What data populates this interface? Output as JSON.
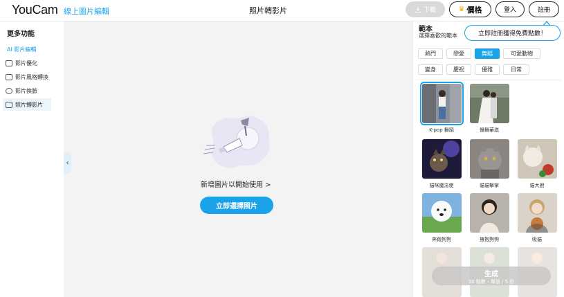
{
  "header": {
    "logo": "YouCam",
    "logo_sub": "線上圖片編輯",
    "title": "照片轉影片",
    "download_label": "下載",
    "price_label": "價格",
    "login_label": "登入",
    "register_label": "註冊"
  },
  "sidebar": {
    "title": "更多功能",
    "section": "AI 影片編輯",
    "items": [
      {
        "label": "影片優化",
        "icon": "video-enhance-icon"
      },
      {
        "label": "影片風格轉換",
        "icon": "style-transfer-icon"
      },
      {
        "label": "影片換臉",
        "icon": "face-swap-icon"
      },
      {
        "label": "照片轉影片",
        "icon": "photo-to-video-icon"
      }
    ]
  },
  "main": {
    "add_prompt": "新增圖片以開始使用 >",
    "cta_label": "立即選擇照片"
  },
  "panel": {
    "title": "範本",
    "subtitle": "選擇喜歡的範本",
    "tooltip": "立即註冊獲得免費點數！",
    "categories": [
      "熱門",
      "戀愛",
      "舞蹈",
      "可愛動物",
      "變身",
      "慶祝",
      "優雅",
      "日常"
    ],
    "active_category": "舞蹈",
    "templates": [
      {
        "label": "K-pop 舞蹈",
        "selected": true
      },
      {
        "label": "慢舞華滋",
        "selected": false
      },
      {
        "label": "貓咪魔法使",
        "selected": false
      },
      {
        "label": "貓貓擊掌",
        "selected": false
      },
      {
        "label": "貓大廚",
        "selected": false
      },
      {
        "label": "奔跑狗狗",
        "selected": false
      },
      {
        "label": "擁抱狗狗",
        "selected": false
      },
      {
        "label": "吸貓",
        "selected": false
      }
    ],
    "generate_label": "生成",
    "generate_sub": "30 點數・單張 / 5 秒"
  },
  "colors": {
    "accent": "#1aa3e8",
    "canvas_bg": "#f3f3f3"
  }
}
